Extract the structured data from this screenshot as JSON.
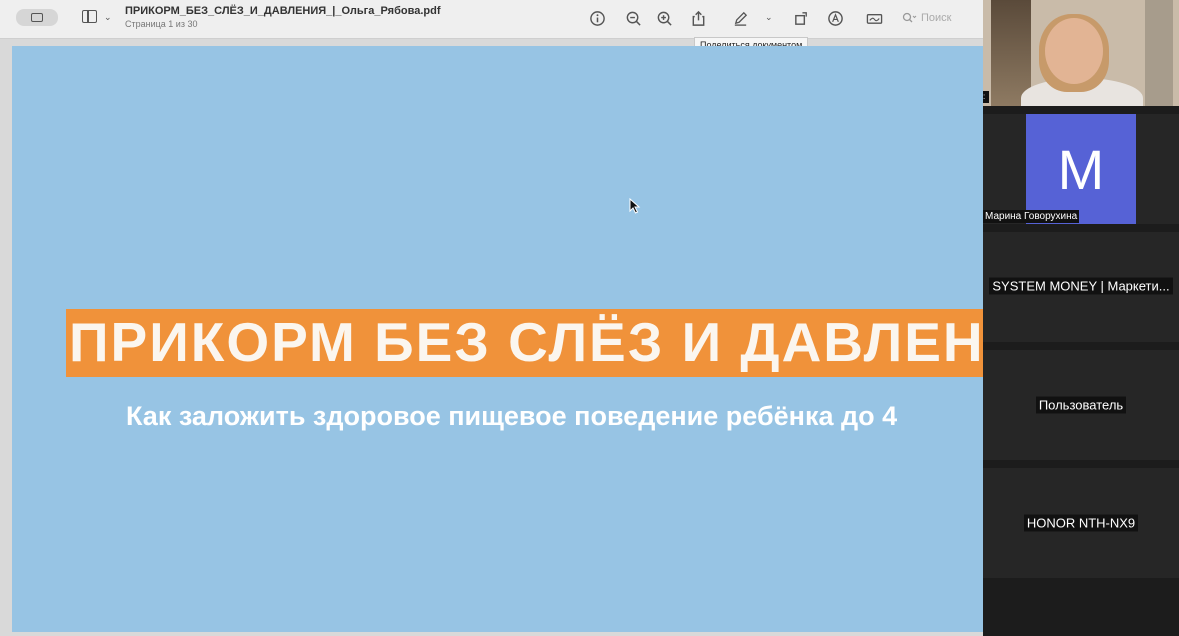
{
  "viewer": {
    "doc_title": "ПРИКОРМ_БЕЗ_СЛЁЗ_И_ДАВЛЕНИЯ_|_Ольга_Рябова.pdf",
    "page_indicator": "Страница 1 из 30",
    "search_placeholder": "Поиск",
    "tooltip": "Поделиться документом",
    "icons": [
      "sidebar-icon",
      "info-icon",
      "zoom-out-icon",
      "zoom-in-icon",
      "share-icon",
      "markup-pen-icon",
      "rotate-icon",
      "markup-circle-icon",
      "signature-icon",
      "search-icon"
    ]
  },
  "slide": {
    "title": "ПРИКОРМ БЕЗ СЛЁЗ И ДАВЛЕНИЯ",
    "subtitle": "Как заложить здоровое пищевое поведение ребёнка до 4",
    "colors": {
      "background": "#97c4e4",
      "title_bar": "#f0923a"
    }
  },
  "participants": [
    {
      "type": "video",
      "tag": ":"
    },
    {
      "type": "avatar",
      "initial": "М",
      "name": "Марина Говорухина",
      "color": "#5662d6"
    },
    {
      "type": "name",
      "name": "SYSTEM MONEY | Маркети..."
    },
    {
      "type": "name",
      "name": "Пользователь"
    },
    {
      "type": "name",
      "name": "HONOR NTH-NX9"
    }
  ]
}
